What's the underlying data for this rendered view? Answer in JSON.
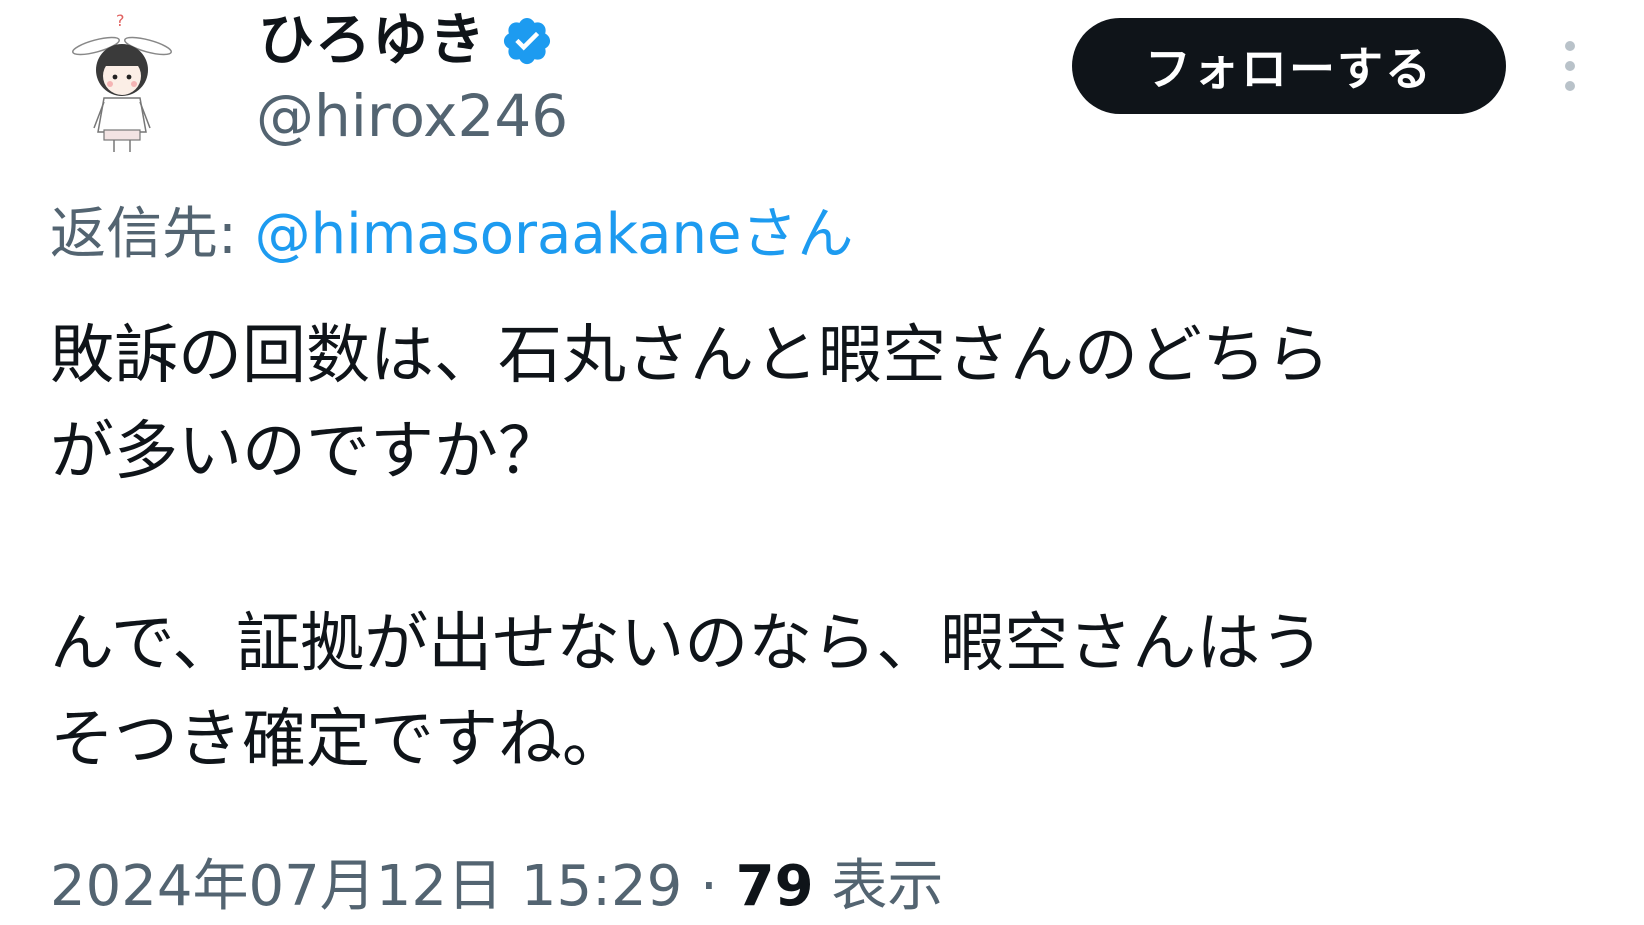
{
  "author": {
    "display_name": "ひろゆき",
    "handle": "@hirox246",
    "verified_icon": "verified-badge-icon",
    "avatar_icon": "bunny-ear-character-avatar"
  },
  "header": {
    "follow_label": "フォローする",
    "more_icon": "vertical-ellipsis-icon"
  },
  "reply": {
    "prefix": "返信先: ",
    "mention": "@himasoraakaneさん"
  },
  "tweet": {
    "lines": [
      "敗訴の回数は、石丸さんと暇空さんのどちら",
      "が多いのですか？",
      "",
      "んで、証拠が出せないのなら、暇空さんはう",
      "そつき確定ですね。"
    ]
  },
  "meta": {
    "timestamp": "2024年07月12日 15:29",
    "separator": " · ",
    "views_count": "79",
    "views_label": " 表示"
  },
  "colors": {
    "text_primary": "#0f1419",
    "text_secondary": "#536471",
    "link_blue": "#1d9bf0",
    "button_bg": "#0f1419",
    "button_text": "#ffffff"
  }
}
